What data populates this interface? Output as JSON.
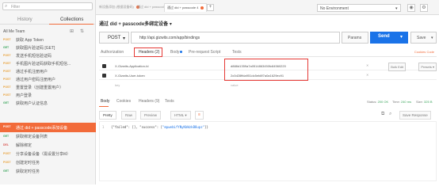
{
  "sidebar": {
    "search_placeholder": "Filter",
    "tabs": [
      "History",
      "Collections"
    ],
    "filter_label": "All   Me   Team",
    "requests": [
      {
        "method": "POST",
        "name": "获取 App Token"
      },
      {
        "method": "GET",
        "name": "获取图片验证码 [GET]"
      },
      {
        "method": "POST",
        "name": "发送手机短信验证码"
      },
      {
        "method": "POST",
        "name": "手机图片验证码获取手机短信..."
      },
      {
        "method": "POST",
        "name": "通过手机注册用户"
      },
      {
        "method": "POST",
        "name": "通过用户密码注册用户"
      },
      {
        "method": "POST",
        "name": "重置登录（创建重置用户）"
      },
      {
        "method": "POST",
        "name": "用户登录"
      },
      {
        "method": "GET",
        "name": "获取用户认证信息"
      },
      {
        "method": "POST",
        "name": "通过 did + passcode添加设备",
        "selected": true
      },
      {
        "method": "GET",
        "name": "获取绑定设备列表"
      },
      {
        "method": "DEL",
        "name": "解除绑定"
      },
      {
        "method": "POST",
        "name": "分享设备设备（需设置分享ttl）"
      },
      {
        "method": "POST",
        "name": "创建定时任务"
      },
      {
        "method": "GET",
        "name": "获取定时任务"
      }
    ]
  },
  "topbar": {
    "tab1": "新设备添加 (根据设备码)",
    "tab2": "通过 did + passcode 4",
    "tab3": "通过 did + passcode 4",
    "plus": "+",
    "environment": "No Environment",
    "env_caret": "▾",
    "eye_icon": "◉",
    "gear_icon": "⚙"
  },
  "request": {
    "title": "通过 did + passcode多绑定设备",
    "title_caret": "▾",
    "method": "POST",
    "method_caret": "▾",
    "url": "http://api.gizwits.com/app/bindings",
    "params_label": "Params",
    "send_label": "Send",
    "send_caret": "▾",
    "save_label": "Save",
    "save_caret": "▾"
  },
  "request_tabs": {
    "authorization": "Authorization",
    "headers": "Headers (2)",
    "body": "Body",
    "prerequest": "Pre-request Script",
    "tests": "Tests",
    "cookies": "Cookies",
    "code": "Code"
  },
  "headers": [
    {
      "key": "X-Gizwits-Application-Id",
      "value": "d888d1359a7a0514863450fc84560220"
    },
    {
      "key": "X-Gizwits-User-token",
      "value": "2c0d28ffda951dc5eb8f7a0a1629ec91"
    }
  ],
  "headers_placeholder": {
    "key": "key",
    "value": "value"
  },
  "bulk_edit": "Bulk Edit",
  "presets": "Presets ▾",
  "response_tabs": {
    "body": "Body",
    "cookies": "Cookies",
    "headers": "Headers (9)",
    "tests": "Tests",
    "status_label": "Status:",
    "status_value": "200 OK",
    "time_label": "Time:",
    "time_value": "240 ms",
    "size_label": "Size:",
    "size_value": "325 B"
  },
  "format_bar": {
    "pretty": "Pretty",
    "raw": "Raw",
    "preview": "Preview",
    "html": "HTML ▾",
    "wrap_icon": "≡",
    "copy_icon": "⧉",
    "search_icon": "⌕",
    "save_response": "Save Response"
  },
  "response_body": {
    "line_no": "1",
    "prefix": "{\"failed\": [], \"success\": [",
    "value": "\"mpwebLfYNyKbWzkB8upz\"",
    "suffix": "]}"
  }
}
